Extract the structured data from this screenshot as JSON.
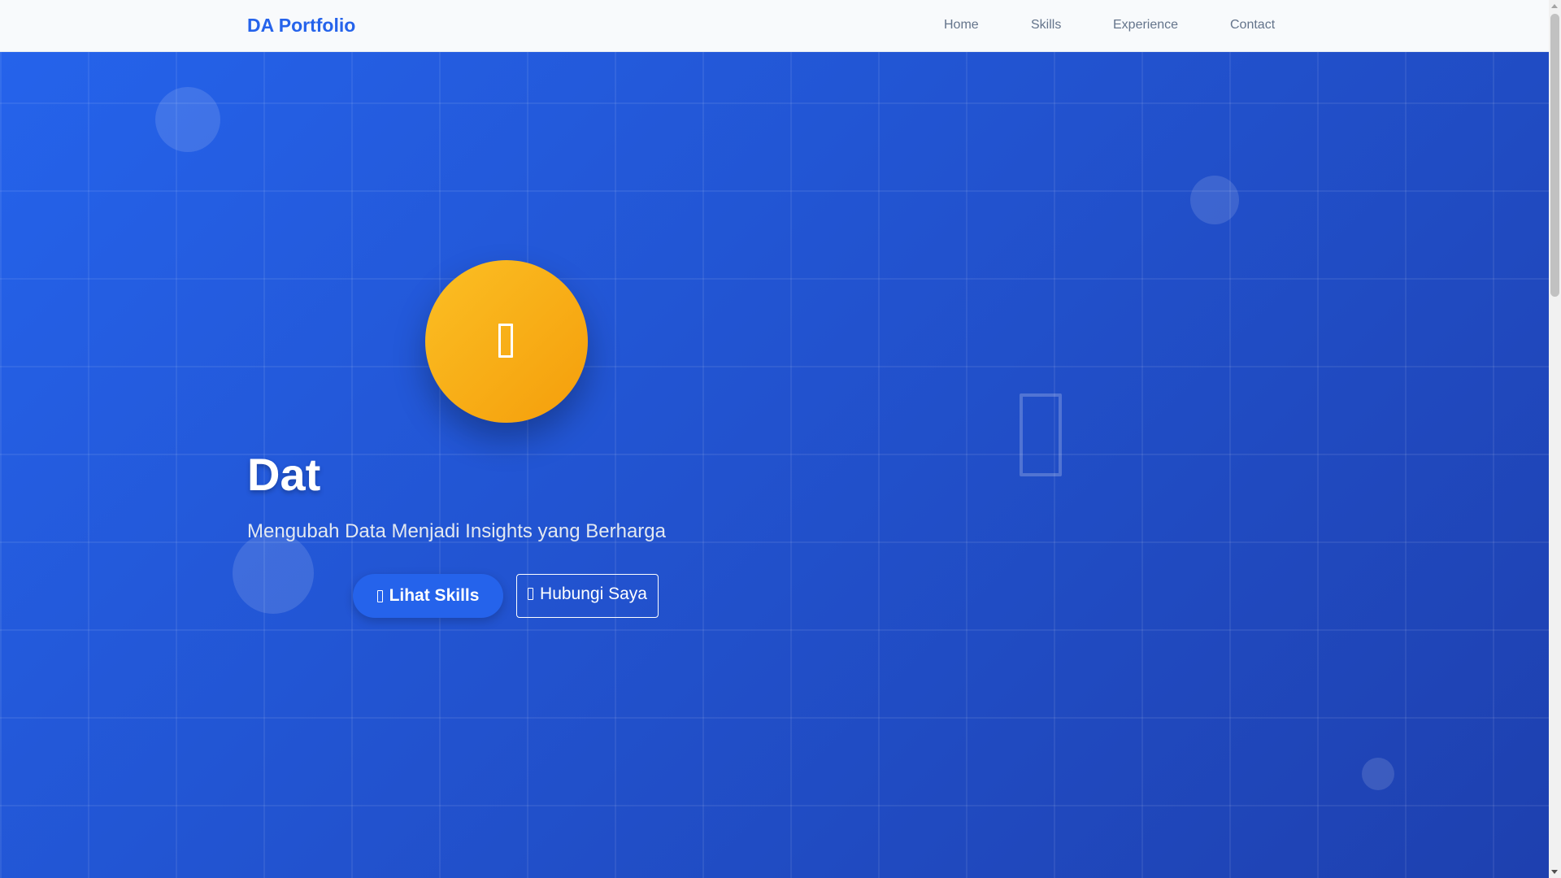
{
  "navbar": {
    "brand": "DA Portfolio",
    "links": [
      "Home",
      "Skills",
      "Experience",
      "Contact"
    ]
  },
  "hero": {
    "name": "Dat",
    "tagline": "Mengubah Data Menjadi Insights yang Berharga",
    "avatar_icon": "missing-glyph-icon",
    "decorative_icon": "missing-glyph-icon",
    "primary_button": {
      "label": "Lihat Skills",
      "icon": "missing-glyph-icon"
    },
    "secondary_button": {
      "label": "Hubungi Saya",
      "icon": "missing-glyph-icon"
    }
  },
  "colors": {
    "accent": "#2563eb",
    "hero_gradient_start": "#2563eb",
    "hero_gradient_end": "#1e40af",
    "avatar_gradient_start": "#fbbf24",
    "avatar_gradient_end": "#f59e0b",
    "nav_text": "#64748b"
  }
}
